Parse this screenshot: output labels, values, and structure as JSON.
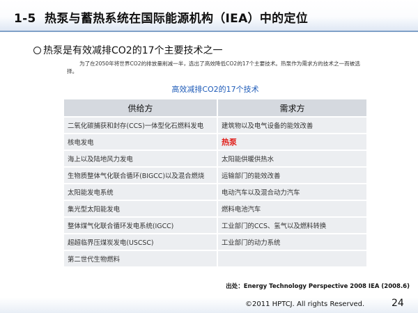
{
  "slide": {
    "title": "1-5  热泵与蓄热系统在国际能源机构（IEA）中的定位",
    "heading": "热泵是有效减排CO2的17个主要技术之一",
    "description": "为了在2050年将世界CO2的排放量削减一半，选出了高效降低CO2的17个主要技术。热泵作为需求方的技术之一而被选择。",
    "table_title": "高效减排CO2的17个技术",
    "table": {
      "headers": [
        "供给方",
        "需求方"
      ],
      "rows": [
        [
          "二氧化碳捕获和封存(CCS)一体型化石燃料发电",
          "建筑物以及电气设备的能效改善"
        ],
        [
          "核电发电",
          "热泵"
        ],
        [
          "海上以及陆地风力发电",
          "太阳能供暖供热水"
        ],
        [
          "生物质整体气化联合循环(BIGCC)以及混合燃烧",
          "运输部门的能效改善"
        ],
        [
          "太阳能发电系统",
          "电动汽车以及混合动力汽车"
        ],
        [
          "集光型太阳能发电",
          "燃料电池汽车"
        ],
        [
          "整体煤气化联合循环发电系统(IGCC)",
          "工业部门的CCS、氢气以及燃料转换"
        ],
        [
          "超超临界压煤炭发电(USCSC)",
          "工业部门的动力系统"
        ],
        [
          "第二世代生物燃料",
          ""
        ]
      ],
      "highlight_color": "#e01b16"
    },
    "source": "出处：Energy Technology Perspective 2008 IEA (2008.6)",
    "copyright": "©2011 HPTCJ. All rights Reserved.",
    "page_number": "24"
  }
}
